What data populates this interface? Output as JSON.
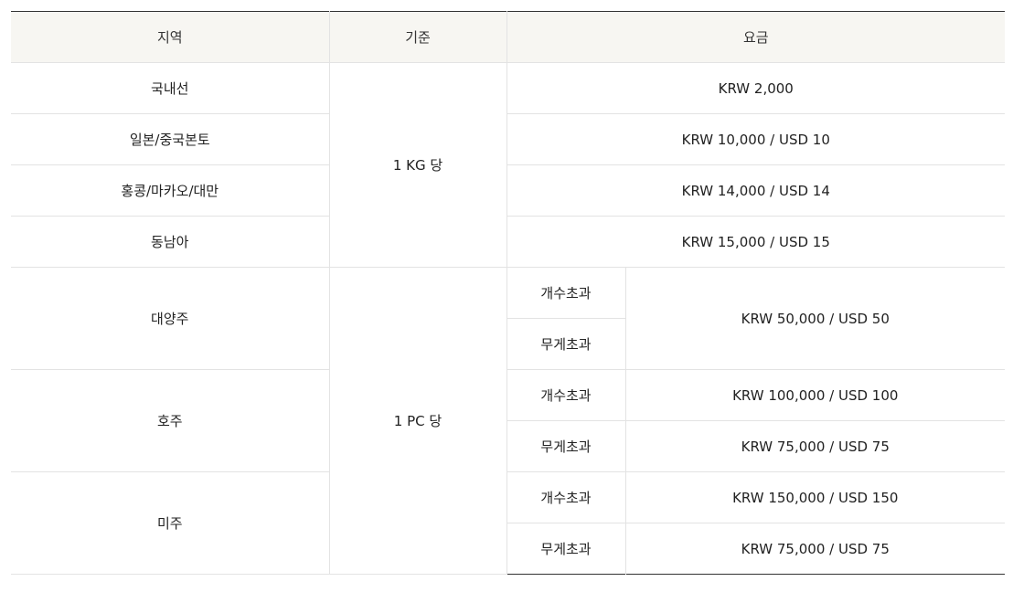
{
  "header": {
    "region": "지역",
    "basis": "기준",
    "fee": "요금"
  },
  "basis": {
    "kg": "1 KG 당",
    "pc": "1 PC 당"
  },
  "kg_rows": [
    {
      "region": "국내선",
      "fee": "KRW 2,000"
    },
    {
      "region": "일본/중국본토",
      "fee": "KRW 10,000 / USD 10"
    },
    {
      "region": "홍콩/마카오/대만",
      "fee": "KRW 14,000 / USD 14"
    },
    {
      "region": "동남아",
      "fee": "KRW 15,000 / USD 15"
    }
  ],
  "pc_groups": [
    {
      "region": "대양주",
      "sub": [
        "개수초과",
        "무게초과"
      ],
      "fee_combined": "KRW 50,000 / USD 50"
    },
    {
      "region": "호주",
      "sub": [
        "개수초과",
        "무게초과"
      ],
      "fees": [
        "KRW 100,000 / USD 100",
        "KRW 75,000 / USD 75"
      ]
    },
    {
      "region": "미주",
      "sub": [
        "개수초과",
        "무게초과"
      ],
      "fees": [
        "KRW 150,000 / USD 150",
        "KRW 75,000 / USD 75"
      ]
    }
  ]
}
